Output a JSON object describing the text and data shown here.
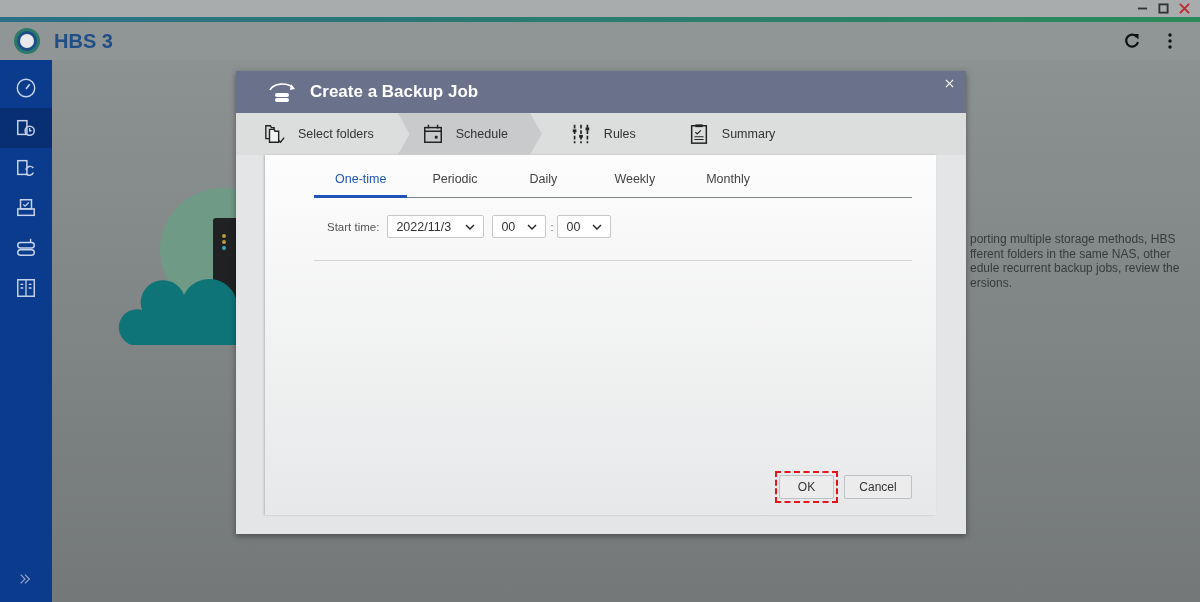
{
  "app": {
    "title": "HBS 3"
  },
  "sidebar": {
    "items": [
      {
        "kind": "dashboard",
        "selected": false
      },
      {
        "kind": "backup",
        "selected": true
      },
      {
        "kind": "sync",
        "selected": false
      },
      {
        "kind": "restore",
        "selected": false
      },
      {
        "kind": "storage",
        "selected": false
      },
      {
        "kind": "services",
        "selected": false
      }
    ]
  },
  "background_text": [
    "porting multiple storage methods, HBS",
    "fferent folders in the same NAS, other",
    "edule recurrent backup jobs, review the",
    "ersions."
  ],
  "dialog": {
    "title": "Create a Backup Job",
    "steps": [
      {
        "label": "Select folders",
        "kind": "folders",
        "selected": false
      },
      {
        "label": "Schedule",
        "kind": "calendar",
        "selected": true
      },
      {
        "label": "Rules",
        "kind": "sliders",
        "selected": false
      },
      {
        "label": "Summary",
        "kind": "clipboard",
        "selected": false
      }
    ],
    "schedule_tabs": [
      {
        "label": "One-time",
        "selected": true
      },
      {
        "label": "Periodic",
        "selected": false
      },
      {
        "label": "Daily",
        "selected": false
      },
      {
        "label": "Weekly",
        "selected": false
      },
      {
        "label": "Monthly",
        "selected": false
      }
    ],
    "start_time": {
      "label": "Start time:",
      "date": "2022/11/3",
      "hour": "00",
      "separator": ":",
      "minute": "00"
    },
    "buttons": [
      {
        "label": "OK",
        "highlighted": true
      },
      {
        "label": "Cancel",
        "highlighted": false
      }
    ]
  }
}
